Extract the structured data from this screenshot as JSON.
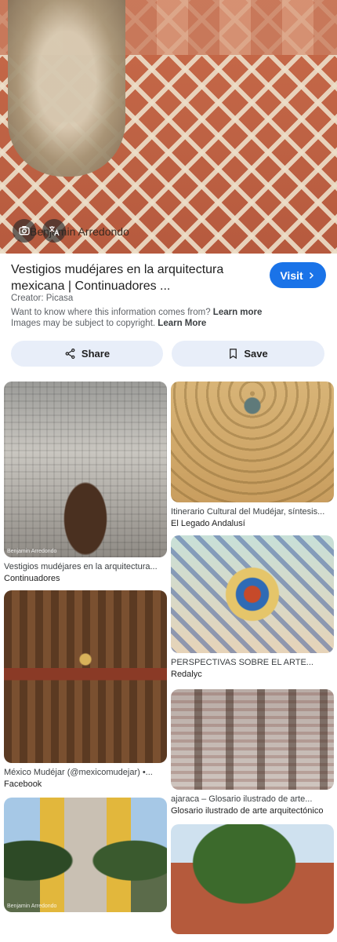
{
  "hero": {
    "credit": "Benjamin Arredondo"
  },
  "result": {
    "title": "Vestigios mudéjares en la arquitectura mexicana | Continuadores ...",
    "visit_label": "Visit",
    "creator": "Creator: Picasa",
    "info_question": "Want to know where this information comes from?",
    "info_link": "Learn more",
    "copyright_text": "Images may be subject to copyright.",
    "copyright_link": "Learn More"
  },
  "actions": {
    "share_label": "Share",
    "save_label": "Save"
  },
  "related": {
    "left": [
      {
        "title": "Vestigios mudéjares en la arquitectura...",
        "source": "Continuadores",
        "watermark": "Benjamin Arredondo"
      },
      {
        "title": "México Mudéjar (@mexicomudejar) •...",
        "source": "Facebook"
      },
      {
        "title": "",
        "source": "",
        "watermark": "Benjamin Arredondo"
      }
    ],
    "right": [
      {
        "title": "Itinerario Cultural del Mudéjar, síntesis...",
        "source": "El Legado Andalusí"
      },
      {
        "title": "PERSPECTIVAS SOBRE EL ARTE...",
        "source": "Redalyc"
      },
      {
        "title": "ajaraca – Glosario ilustrado de arte...",
        "source": "Glosario ilustrado de arte arquitectónico"
      },
      {
        "title": "",
        "source": ""
      }
    ]
  },
  "icons": {
    "lens": "lens-icon",
    "translate": "translate-icon",
    "share": "share-icon",
    "save": "bookmark-icon",
    "visit": "chevron-right-icon"
  },
  "colors": {
    "accent": "#1a73e8",
    "action_bg": "#e8eef9"
  }
}
